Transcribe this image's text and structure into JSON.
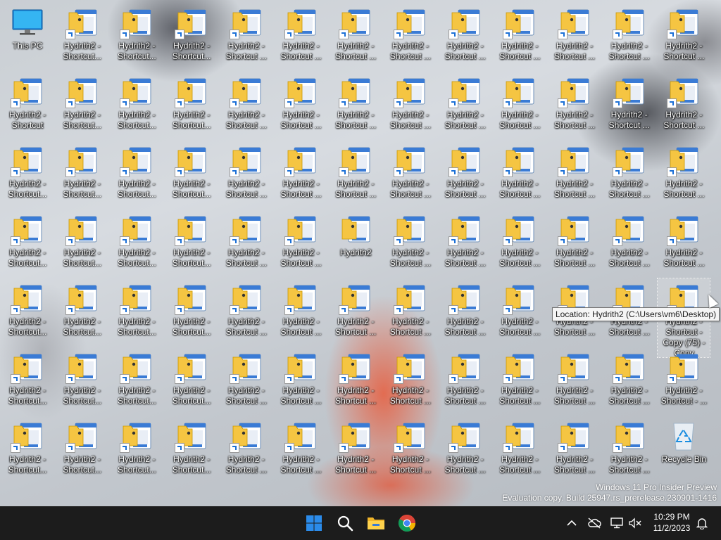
{
  "desktop": {
    "icons": [
      {
        "l1": "This PC",
        "l2": "",
        "type": "pc"
      },
      {
        "l1": "Hydrith2 -",
        "l2": "Shortcut..."
      },
      {
        "l1": "Hydrith2 -",
        "l2": "Shortcut..."
      },
      {
        "l1": "Hydrith2 -",
        "l2": "Shortcut..."
      },
      {
        "l1": "Hydrith2 -",
        "l2": "Shortcut ..."
      },
      {
        "l1": "Hydrith2 -",
        "l2": "Shortcut ..."
      },
      {
        "l1": "Hydrith2 -",
        "l2": "Shortcut ..."
      },
      {
        "l1": "Hydrith2 -",
        "l2": "Shortcut ..."
      },
      {
        "l1": "Hydrith2 -",
        "l2": "Shortcut ..."
      },
      {
        "l1": "Hydrith2 -",
        "l2": "Shortcut ..."
      },
      {
        "l1": "Hydrith2 -",
        "l2": "Shortcut ..."
      },
      {
        "l1": "Hydrith2 -",
        "l2": "Shortcut ..."
      },
      {
        "l1": "Hydrith2 -",
        "l2": "Shortcut ..."
      },
      {
        "l1": "Hydrith2 -",
        "l2": "Shortcut"
      },
      {
        "l1": "Hydrith2 -",
        "l2": "Shortcut..."
      },
      {
        "l1": "Hydrith2 -",
        "l2": "Shortcut..."
      },
      {
        "l1": "Hydrith2 -",
        "l2": "Shortcut..."
      },
      {
        "l1": "Hydrith2 -",
        "l2": "Shortcut ..."
      },
      {
        "l1": "Hydrith2 -",
        "l2": "Shortcut ..."
      },
      {
        "l1": "Hydrith2 -",
        "l2": "Shortcut ..."
      },
      {
        "l1": "Hydrith2 -",
        "l2": "Shortcut ..."
      },
      {
        "l1": "Hydrith2 -",
        "l2": "Shortcut ..."
      },
      {
        "l1": "Hydrith2 -",
        "l2": "Shortcut ..."
      },
      {
        "l1": "Hydrith2 -",
        "l2": "Shortcut ..."
      },
      {
        "l1": "Hydrith2 -",
        "l2": "Shortcut ..."
      },
      {
        "l1": "Hydrith2 -",
        "l2": "Shortcut ..."
      },
      {
        "l1": "Hydrith2 -",
        "l2": "Shortcut..."
      },
      {
        "l1": "Hydrith2 -",
        "l2": "Shortcut..."
      },
      {
        "l1": "Hydrith2 -",
        "l2": "Shortcut..."
      },
      {
        "l1": "Hydrith2 -",
        "l2": "Shortcut..."
      },
      {
        "l1": "Hydrith2 -",
        "l2": "Shortcut ..."
      },
      {
        "l1": "Hydrith2 -",
        "l2": "Shortcut ..."
      },
      {
        "l1": "Hydrith2 -",
        "l2": "Shortcut ..."
      },
      {
        "l1": "Hydrith2 -",
        "l2": "Shortcut ..."
      },
      {
        "l1": "Hydrith2 -",
        "l2": "Shortcut ..."
      },
      {
        "l1": "Hydrith2 -",
        "l2": "Shortcut ..."
      },
      {
        "l1": "Hydrith2 -",
        "l2": "Shortcut ..."
      },
      {
        "l1": "Hydrith2 -",
        "l2": "Shortcut ..."
      },
      {
        "l1": "Hydrith2 -",
        "l2": "Shortcut ..."
      },
      {
        "l1": "Hydrith2 -",
        "l2": "Shortcut..."
      },
      {
        "l1": "Hydrith2 -",
        "l2": "Shortcut..."
      },
      {
        "l1": "Hydrith2 -",
        "l2": "Shortcut..."
      },
      {
        "l1": "Hydrith2 -",
        "l2": "Shortcut..."
      },
      {
        "l1": "Hydrith2 -",
        "l2": "Shortcut ..."
      },
      {
        "l1": "Hydrith2 -",
        "l2": "Shortcut ..."
      },
      {
        "l1": "Hydrith2",
        "l2": "",
        "type": "original"
      },
      {
        "l1": "Hydrith2 -",
        "l2": "Shortcut ..."
      },
      {
        "l1": "Hydrith2 -",
        "l2": "Shortcut ..."
      },
      {
        "l1": "Hydrith2 -",
        "l2": "Shortcut ..."
      },
      {
        "l1": "Hydrith2 -",
        "l2": "Shortcut ..."
      },
      {
        "l1": "Hydrith2 -",
        "l2": "Shortcut ..."
      },
      {
        "l1": "Hydrith2 -",
        "l2": "Shortcut ..."
      },
      {
        "l1": "Hydrith2 -",
        "l2": "Shortcut..."
      },
      {
        "l1": "Hydrith2 -",
        "l2": "Shortcut..."
      },
      {
        "l1": "Hydrith2 -",
        "l2": "Shortcut..."
      },
      {
        "l1": "Hydrith2 -",
        "l2": "Shortcut..."
      },
      {
        "l1": "Hydrith2 -",
        "l2": "Shortcut ..."
      },
      {
        "l1": "Hydrith2 -",
        "l2": "Shortcut ..."
      },
      {
        "l1": "Hydrith2 -",
        "l2": "Shortcut ..."
      },
      {
        "l1": "Hydrith2 -",
        "l2": "Shortcut ..."
      },
      {
        "l1": "Hydrith2 -",
        "l2": "Shortcut ..."
      },
      {
        "l1": "Hydrith2 -",
        "l2": "Shortcut ..."
      },
      {
        "l1": "Hydrith2 -",
        "l2": "Shortcut ..."
      },
      {
        "l1": "Hydrith2 -",
        "l2": "Shortcut ..."
      },
      {
        "l1": "Hydrith2 -",
        "l2": "Shortcut - Copy (75) - Copy",
        "selected": true
      },
      {
        "l1": "Hydrith2 -",
        "l2": "Shortcut..."
      },
      {
        "l1": "Hydrith2 -",
        "l2": "Shortcut..."
      },
      {
        "l1": "Hydrith2 -",
        "l2": "Shortcut..."
      },
      {
        "l1": "Hydrith2 -",
        "l2": "Shortcut..."
      },
      {
        "l1": "Hydrith2 -",
        "l2": "Shortcut ..."
      },
      {
        "l1": "Hydrith2 -",
        "l2": "Shortcut ..."
      },
      {
        "l1": "Hydrith2 -",
        "l2": "Shortcut ..."
      },
      {
        "l1": "Hydrith2 -",
        "l2": "Shortcut ..."
      },
      {
        "l1": "Hydrith2 -",
        "l2": "Shortcut ..."
      },
      {
        "l1": "Hydrith2 -",
        "l2": "Shortcut ..."
      },
      {
        "l1": "Hydrith2 -",
        "l2": "Shortcut ..."
      },
      {
        "l1": "Hydrith2 -",
        "l2": "Shortcut ..."
      },
      {
        "l1": "Hydrith2 -",
        "l2": "Shortcut - ..."
      },
      {
        "l1": "Hydrith2 -",
        "l2": "Shortcut..."
      },
      {
        "l1": "Hydrith2 -",
        "l2": "Shortcut..."
      },
      {
        "l1": "Hydrith2 -",
        "l2": "Shortcut..."
      },
      {
        "l1": "Hydrith2 -",
        "l2": "Shortcut..."
      },
      {
        "l1": "Hydrith2 -",
        "l2": "Shortcut ..."
      },
      {
        "l1": "Hydrith2 -",
        "l2": "Shortcut ..."
      },
      {
        "l1": "Hydrith2 -",
        "l2": "Shortcut ..."
      },
      {
        "l1": "Hydrith2 -",
        "l2": "Shortcut ..."
      },
      {
        "l1": "Hydrith2 -",
        "l2": "Shortcut ..."
      },
      {
        "l1": "Hydrith2 -",
        "l2": "Shortcut ..."
      },
      {
        "l1": "Hydrith2 -",
        "l2": "Shortcut ..."
      },
      {
        "l1": "Hydrith2 -",
        "l2": "Shortcut ..."
      },
      {
        "l1": "Recycle Bin",
        "l2": "",
        "type": "bin"
      }
    ]
  },
  "tooltip": {
    "text": "Location: Hydrith2 (C:\\Users\\vm6\\Desktop)"
  },
  "watermark": {
    "line1": "Windows 11 Pro Insider Preview",
    "line2": "Evaluation copy. Build 25947.rs_prerelease.230901-1416"
  },
  "taskbar": {
    "apps": [
      {
        "name": "start-button",
        "icon": "windows-logo-icon"
      },
      {
        "name": "search-button",
        "icon": "search-icon"
      },
      {
        "name": "file-explorer-button",
        "icon": "folder-icon"
      },
      {
        "name": "chrome-button",
        "icon": "chrome-icon"
      }
    ],
    "clock": {
      "time": "10:29 PM",
      "date": "11/2/2023"
    }
  },
  "colors": {
    "taskbar_bg": "#1c1c1c",
    "start_blue": "#2b8bea",
    "folder_yellow": "#f5c542",
    "doc_blue": "#3a7bd5"
  }
}
